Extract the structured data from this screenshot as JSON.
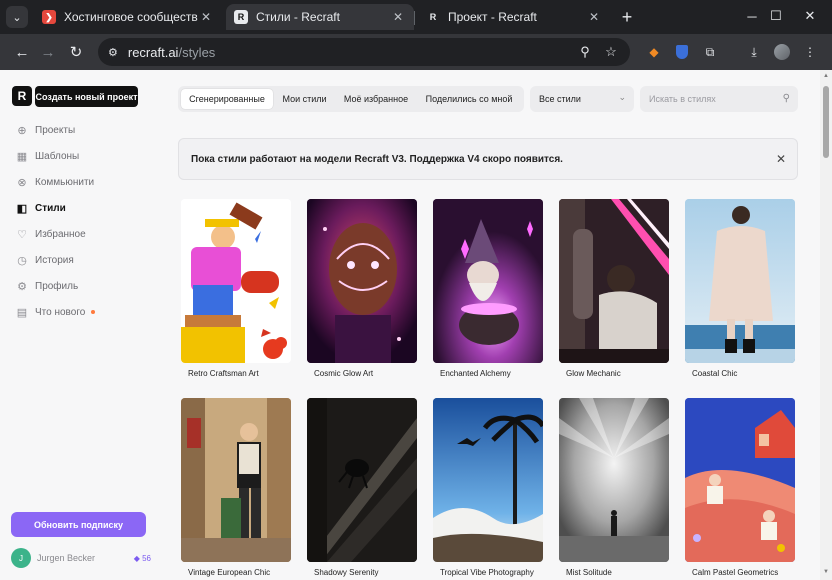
{
  "browser": {
    "tabs": [
      {
        "title": "Хостинговое сообщество «Tim",
        "active": false
      },
      {
        "title": "Стили - Recraft",
        "active": true
      },
      {
        "title": "Проект - Recraft",
        "active": false
      }
    ],
    "close_glyph": "✕",
    "new_tab_glyph": "+",
    "url_host": "recraft.ai",
    "url_path": "/styles"
  },
  "sidebar": {
    "create_label": "Создать новый проект",
    "items": [
      {
        "label": "Проекты",
        "icon": "plus-circle-icon"
      },
      {
        "label": "Шаблоны",
        "icon": "grid-icon"
      },
      {
        "label": "Коммьюнити",
        "icon": "globe-icon"
      },
      {
        "label": "Стили",
        "icon": "styles-icon",
        "active": true
      },
      {
        "label": "Избранное",
        "icon": "heart-icon"
      },
      {
        "label": "История",
        "icon": "history-icon"
      },
      {
        "label": "Профиль",
        "icon": "settings-icon"
      },
      {
        "label": "Что нового",
        "icon": "document-icon"
      }
    ],
    "upgrade_label": "Обновить подписку",
    "user": {
      "initial": "J",
      "name": "Jurgen Becker",
      "credits": "◆ 56"
    }
  },
  "filters": {
    "tabs": [
      {
        "label": "Сгенерированные",
        "active": true
      },
      {
        "label": "Мои стили"
      },
      {
        "label": "Моё избранное"
      },
      {
        "label": "Поделились со мной"
      }
    ],
    "select_value": "Все стили",
    "search_placeholder": "Искать в стилях"
  },
  "banner": {
    "text": "Пока стили работают на модели Recraft V3. Поддержка V4 скоро появится."
  },
  "styles": [
    {
      "name": "Retro Craftsman Art"
    },
    {
      "name": "Cosmic Glow Art"
    },
    {
      "name": "Enchanted Alchemy"
    },
    {
      "name": "Glow Mechanic"
    },
    {
      "name": "Coastal Chic"
    },
    {
      "name": "Vintage European Chic"
    },
    {
      "name": "Shadowy Serenity"
    },
    {
      "name": "Tropical Vibe Photography"
    },
    {
      "name": "Mist Solitude"
    },
    {
      "name": "Calm Pastel Geometrics"
    }
  ],
  "colors": {
    "accent": "#8b67f5",
    "dark": "#111111",
    "whats_new_dot": "#ff7a3d"
  }
}
